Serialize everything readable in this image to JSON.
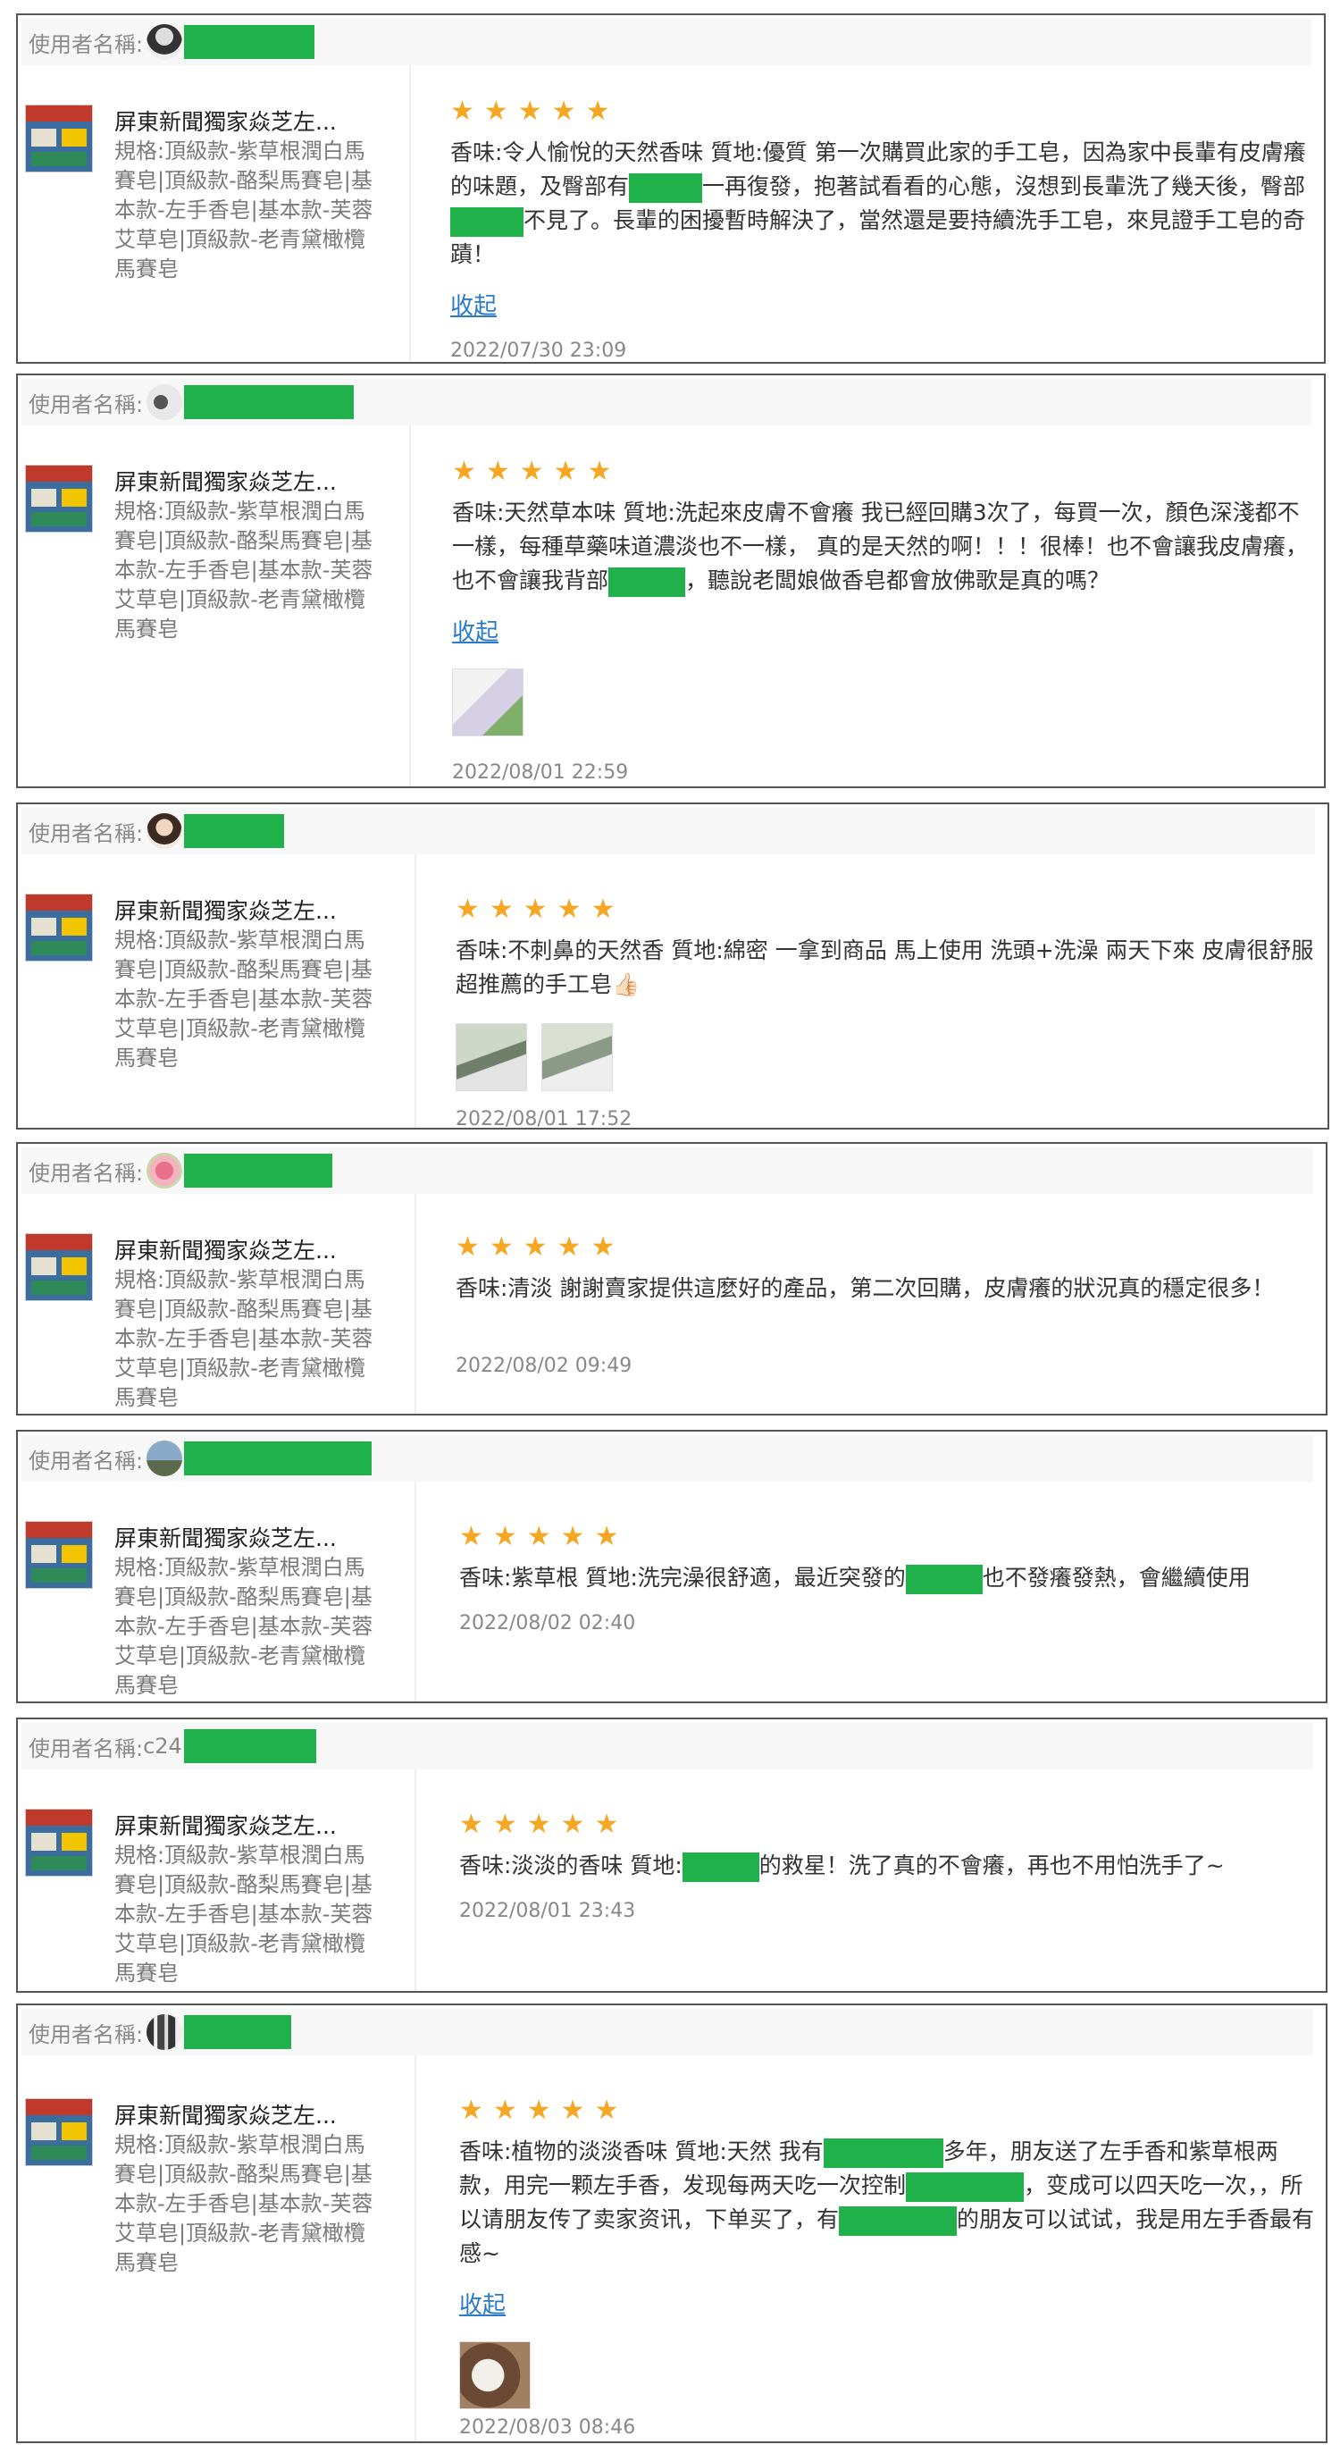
{
  "common": {
    "user_label": "使用者名稱:",
    "product_name": "屏東新聞獨家焱芝左...",
    "product_spec": "規格:頂級款-紫草根潤白馬賽皂|頂級款-酪梨馬賽皂|基本款-左手香皂|基本款-芙蓉艾草皂|頂級款-老青黛橄欖馬賽皂",
    "product_spec_alt": "規格:頂級款-紫草根潤白馬賽皂|頂級款-酪梨馬賽皂|基本款-左手香皂|基本款-芙蓉艾草皂|頂級款-老青黛橄欖馬賽皂",
    "collapse_label": "收起",
    "stars": "★★★★★",
    "accent_color": "#f5a623",
    "redact_color": "#21b14a",
    "link_color": "#2a7ac5"
  },
  "reviews": [
    {
      "user_suffix": "",
      "text_parts": [
        "香味:令人愉悅的天然香味 質地:優質 第一次購買此家的手工皂，因為家中長輩有皮膚癢的味題，及臀部有",
        "一再復發，抱著試看看的心態，沒想到長輩洗了幾天後，臀部",
        "不見了。長輩的困擾暫時解決了，當然還是要持續洗手工皂，來見證手工皂的奇蹟！"
      ],
      "date": "2022/07/30 23:09"
    },
    {
      "user_suffix": "",
      "text_parts": [
        "香味:天然草本味 質地:洗起來皮膚不會癢 我已經回購3次了，每買一次，顏色深淺都不一樣，每種草藥味道濃淡也不一樣， 真的是天然的啊！！！很棒！也不會讓我皮膚癢，也不會讓我背部",
        "，聽說老闆娘做香皂都會放佛歌是真的嗎？"
      ],
      "date": "2022/08/01 22:59"
    },
    {
      "user_suffix": "",
      "text_parts": [
        "香味:不刺鼻的天然香 質地:綿密 一拿到商品 馬上使用 洗頭+洗澡 兩天下來 皮膚很舒服 超推薦的手工皂👍🏻"
      ],
      "date": "2022/08/01 17:52"
    },
    {
      "user_suffix": "",
      "text_parts": [
        "香味:清淡 謝謝賣家提供這麼好的產品，第二次回購，皮膚癢的狀況真的穩定很多！"
      ],
      "date": "2022/08/02 09:49"
    },
    {
      "user_suffix": "",
      "text_parts": [
        "香味:紫草根 質地:洗完澡很舒適，最近突發的",
        "也不發癢發熱，會繼續使用"
      ],
      "date": "2022/08/02 02:40"
    },
    {
      "user_suffix": "c24",
      "text_parts": [
        "香味:淡淡的香味 質地:",
        "的救星！洗了真的不會癢，再也不用怕洗手了~"
      ],
      "date": "2022/08/01 23:43"
    },
    {
      "user_suffix": "",
      "text_parts": [
        "香味:植物的淡淡香味 質地:天然 我有",
        "多年，朋友送了左手香和紫草根两款，用完一颗左手香，发现每两天吃一次控制",
        "，变成可以四天吃一次，，所以请朋友传了卖家资讯，下单买了，有",
        "的朋友可以试试，我是用左手香最有感~"
      ],
      "date": "2022/08/03 08:46"
    }
  ]
}
